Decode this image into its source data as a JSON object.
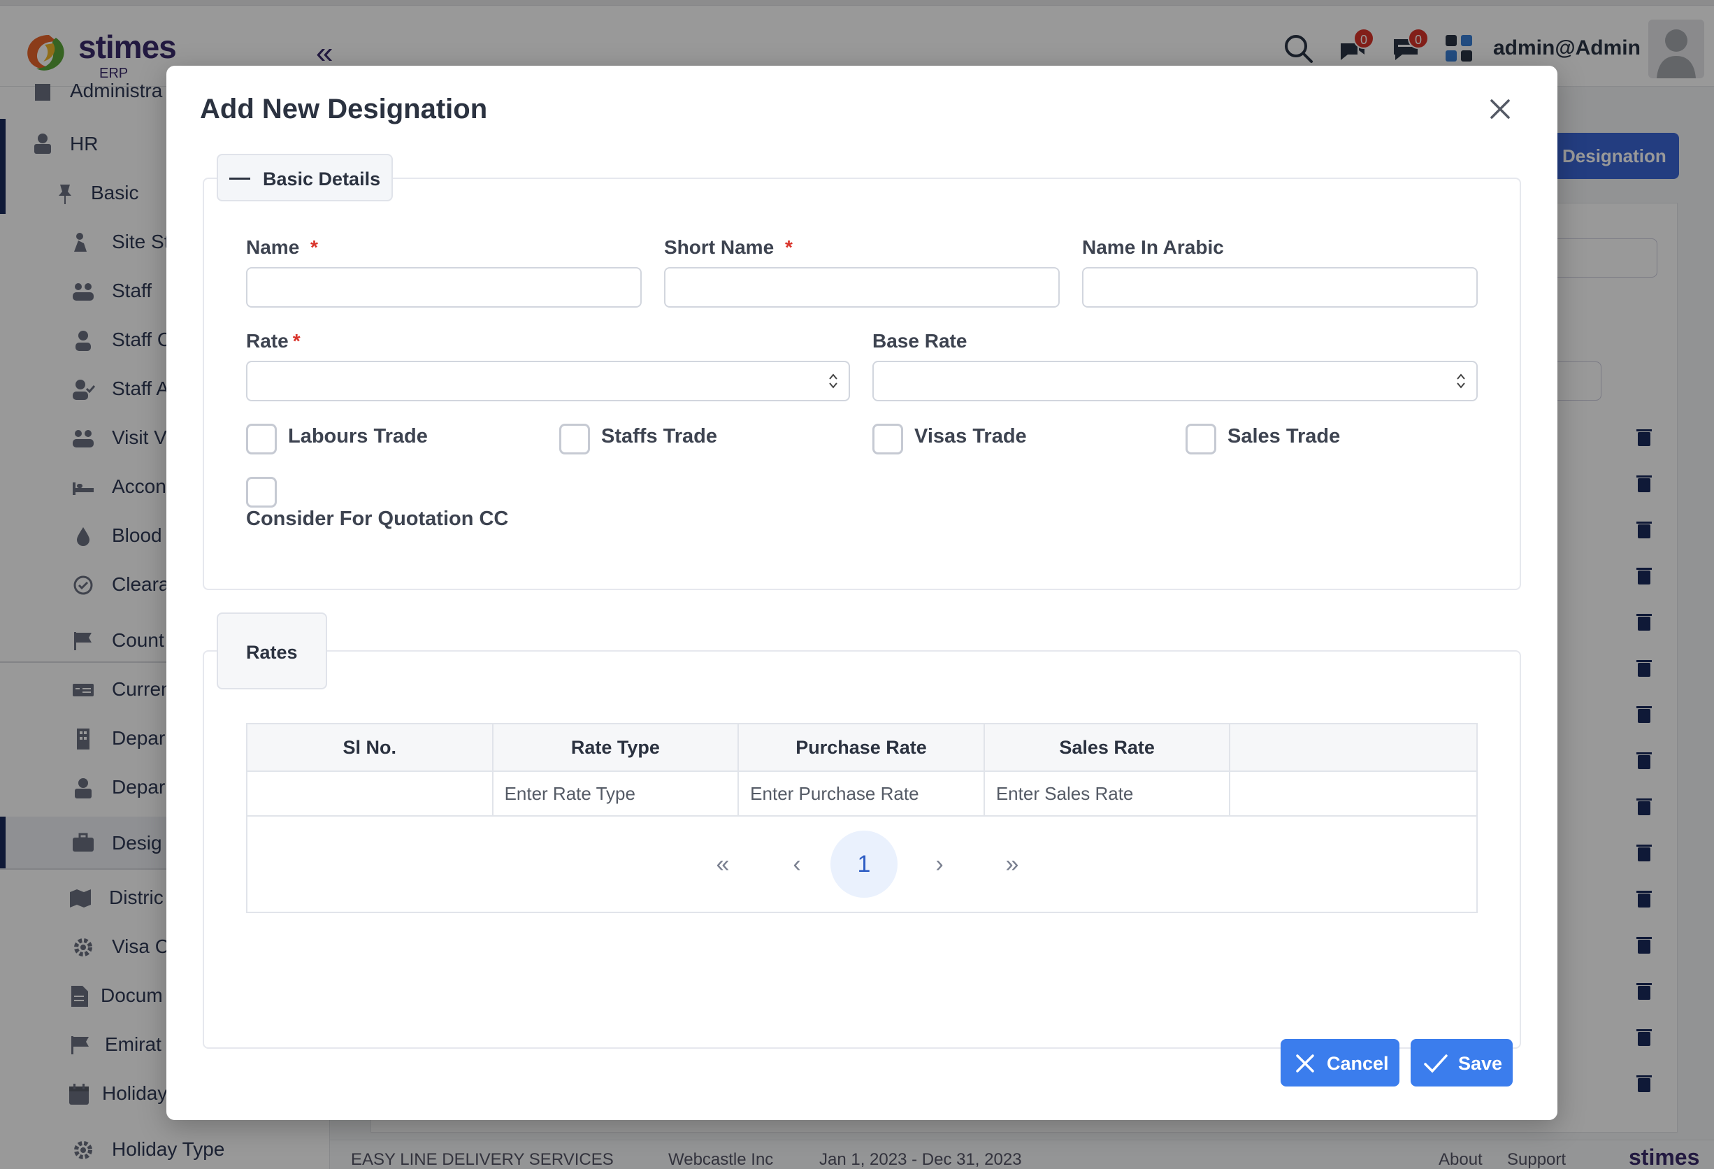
{
  "app": {
    "brand": "stimes",
    "brand_sub": "ERP",
    "user": "admin@Admin",
    "notifications_count": "0",
    "messages_count": "0",
    "bg_button_label": "Designation"
  },
  "sidebar": {
    "items": [
      {
        "label": "Administra",
        "icon": "building-icon"
      },
      {
        "label": "HR",
        "icon": "hr-icon"
      },
      {
        "label": "Basic",
        "icon": "pin-icon"
      },
      {
        "label": "Site St",
        "icon": "site-icon"
      },
      {
        "label": "Staff",
        "icon": "users-icon"
      },
      {
        "label": "Staff C",
        "icon": "user-icon"
      },
      {
        "label": "Staff A",
        "icon": "user-check-icon"
      },
      {
        "label": "Visit V",
        "icon": "users-icon"
      },
      {
        "label": "Accon",
        "icon": "bed-icon"
      },
      {
        "label": "Blood",
        "icon": "drop-icon"
      },
      {
        "label": "Cleara",
        "icon": "check-circle-icon"
      },
      {
        "label": "Count",
        "icon": "flag-icon"
      },
      {
        "label": "Curren",
        "icon": "money-icon"
      },
      {
        "label": "Depar",
        "icon": "building-icon"
      },
      {
        "label": "Depar",
        "icon": "hr-icon"
      },
      {
        "label": "Desig",
        "icon": "briefcase-icon"
      },
      {
        "label": "Distric",
        "icon": "map-icon"
      },
      {
        "label": "Visa C",
        "icon": "gear-icon"
      },
      {
        "label": "Docum",
        "icon": "document-icon"
      },
      {
        "label": "Emirat",
        "icon": "flag-icon"
      },
      {
        "label": "Holiday",
        "icon": "calendar-icon"
      },
      {
        "label": "Holiday Type",
        "icon": "gear-icon"
      }
    ]
  },
  "footer": {
    "company": "EASY LINE DELIVERY SERVICES",
    "vendor": "Webcastle Inc",
    "period": "Jan 1, 2023 - Dec 31, 2023",
    "about": "About",
    "support": "Support",
    "brand": "stimes"
  },
  "modal": {
    "title": "Add New Designation",
    "basic_section": "Basic Details",
    "fields": {
      "name": "Name",
      "short_name": "Short Name",
      "name_arabic": "Name In Arabic",
      "rate": "Rate",
      "base_rate": "Base Rate",
      "required_mark": "*"
    },
    "checkboxes": {
      "labours": "Labours Trade",
      "staffs": "Staffs Trade",
      "visas": "Visas Trade",
      "sales": "Sales Trade",
      "quotation": "Consider For Quotation CC"
    },
    "rates_section": "Rates",
    "table": {
      "headers": [
        "Sl No.",
        "Rate Type",
        "Purchase Rate",
        "Sales Rate",
        ""
      ],
      "placeholders": [
        "",
        "Enter Rate Type",
        "Enter Purchase Rate",
        "Enter Sales Rate",
        ""
      ]
    },
    "pagination": {
      "first": "«",
      "prev": "‹",
      "current": "1",
      "next": "›",
      "last": "»"
    },
    "buttons": {
      "cancel": "Cancel",
      "save": "Save"
    }
  },
  "colors": {
    "primary": "#3b7ded",
    "required": "#d9342b",
    "nav": "#1a2a5c"
  }
}
